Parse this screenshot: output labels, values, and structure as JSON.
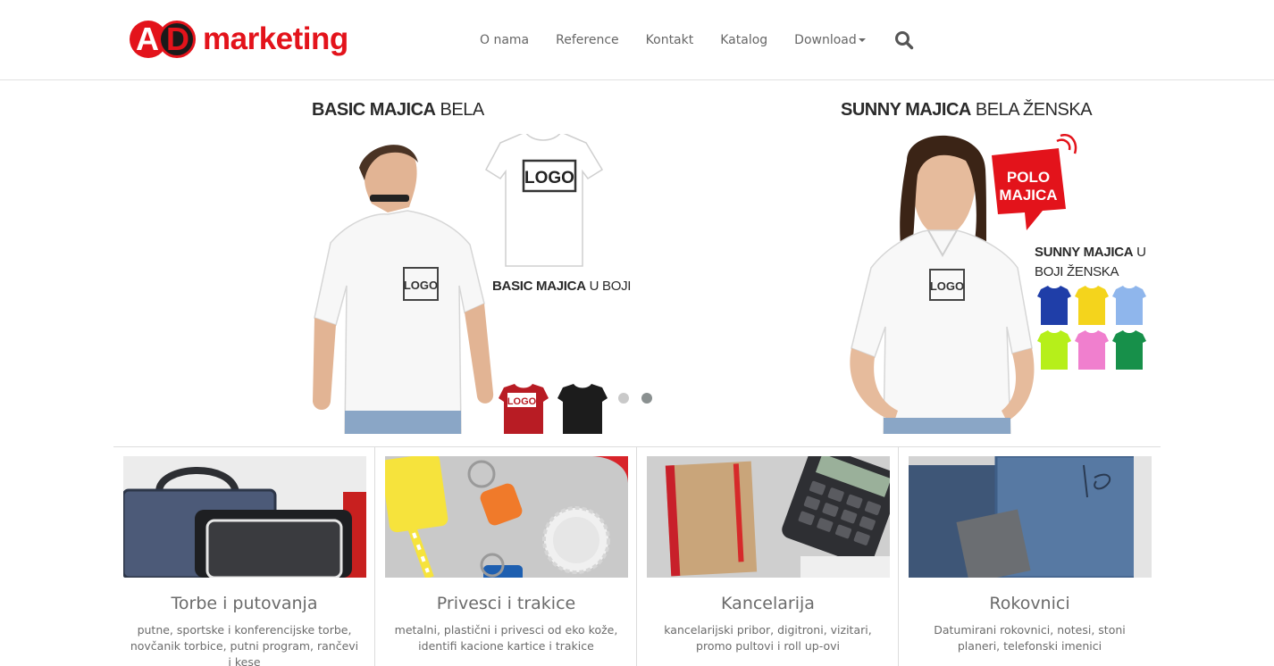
{
  "brand": {
    "logo_letters": "AD",
    "logo_letter_a": "A",
    "logo_letter_d": "D",
    "logo_text": "marketing",
    "accent_color": "#e3131b"
  },
  "nav": {
    "items": [
      {
        "label": "O nama"
      },
      {
        "label": "Reference"
      },
      {
        "label": "Kontakt"
      },
      {
        "label": "Katalog"
      },
      {
        "label": "Download"
      }
    ],
    "search_icon": "search-icon"
  },
  "slider": {
    "slides": [
      {
        "title_bold": "BASIC MAJICA",
        "title_rest": " BELA",
        "sub_bold": "BASIC MAJICA",
        "sub_rest": " U BOJI",
        "logo_label": "LOGO"
      },
      {
        "title_bold": "SUNNY MAJICA",
        "title_rest": " BELA ŽENSKA",
        "badge_line1": "POLO",
        "badge_line2": "MAJICA",
        "sub_bold": "SUNNY MAJICA",
        "sub_rest": " U",
        "sub_line2": "BOJI ŽENSKA",
        "logo_label": "LOGO"
      }
    ],
    "dot_count": 2,
    "active_dot": 2
  },
  "categories": [
    {
      "title": "Torbe i putovanja",
      "desc": "putne, sportske i konferencijske torbe, novčanik torbice, putni program, rančevi i kese",
      "icon": "bag-image"
    },
    {
      "title": "Privesci i trakice",
      "desc": "metalni, plastični i privesci od eko kože, identifi kacione kartice i trakice",
      "icon": "keychain-image"
    },
    {
      "title": "Kancelarija",
      "desc": "kancelarijski pribor, digitroni, vizitari, promo pultovi i roll up-ovi",
      "icon": "office-image"
    },
    {
      "title": "Rokovnici",
      "desc": "Datumirani rokovnici, notesi, stoni planeri, telefonski imenici",
      "icon": "notebook-image"
    }
  ]
}
